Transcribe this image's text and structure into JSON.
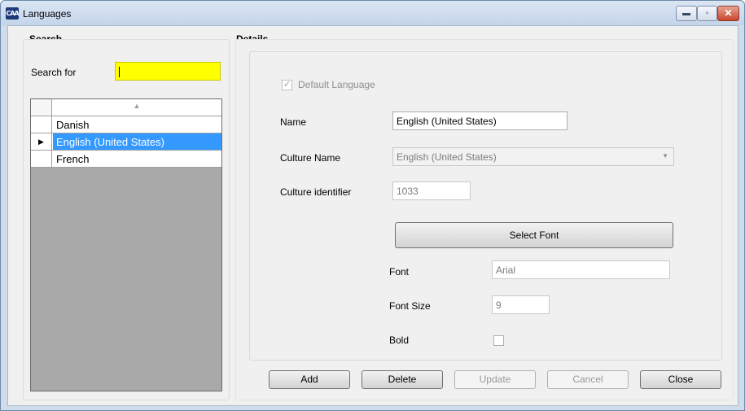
{
  "window": {
    "title": "Languages",
    "icon": "app-logo-icon",
    "controls": {
      "minimize": "minimize-icon",
      "maximize": "maximize-icon",
      "close": "close-icon"
    }
  },
  "search": {
    "group_title": "Search",
    "label": "Search for",
    "value": "",
    "highlight_color": "#ffff00"
  },
  "grid": {
    "sort_indicator": "sort-ascending-icon",
    "rows": [
      {
        "indicator": "",
        "name": "Danish"
      },
      {
        "indicator": "▶",
        "name": "English (United States)",
        "selected": true
      },
      {
        "indicator": "",
        "name": "French"
      }
    ]
  },
  "details": {
    "group_title": "Details",
    "default_language_label": "Default Language",
    "default_language_checked": true,
    "name_label": "Name",
    "name_value": "English (United States)",
    "culture_name_label": "Culture Name",
    "culture_name_value": "English (United States)",
    "culture_id_label": "Culture identifier",
    "culture_id_value": "1033",
    "select_font_label": "Select Font",
    "font_label": "Font",
    "font_value": "Arial",
    "font_size_label": "Font Size",
    "font_size_value": "9",
    "bold_label": "Bold",
    "bold_checked": false
  },
  "buttons": {
    "add": "Add",
    "delete": "Delete",
    "update": "Update",
    "cancel": "Cancel",
    "close": "Close"
  },
  "colors": {
    "selection": "#3399ff",
    "search_highlight": "#ffff00"
  }
}
